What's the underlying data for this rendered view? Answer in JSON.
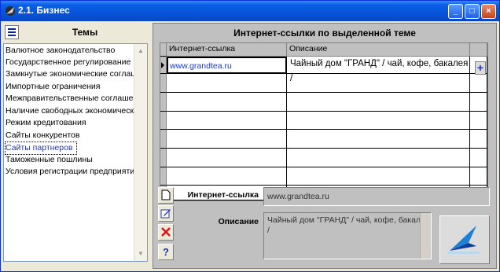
{
  "window": {
    "title": "2.1. Бизнес"
  },
  "title_buttons": {
    "minimize": "_",
    "maximize": "□",
    "close": "×"
  },
  "left": {
    "title": "Темы",
    "items": [
      "Валютное законодательство",
      "Государственное регулирование",
      "Замкнутые экономические соглашения",
      "Импортные ограничения",
      "Межправительственные соглашения",
      "Наличие свободных экономических зон",
      "Режим кредитования",
      "Сайты конкурентов",
      "Сайты партнеров",
      "Таможенные пошлины",
      "Условия регистрации предприятий"
    ],
    "selected_index": 8
  },
  "right": {
    "title": "Интернет-ссылки по выделенной теме",
    "columns": [
      "Интернет-ссылка",
      "Описание"
    ],
    "rows": [
      {
        "url": "www.grandtea.ru",
        "description": "Чайный дом \"ГРАНД\" / чай, кофе, бакалея /"
      }
    ],
    "plus_label": "+",
    "detail": {
      "url_label": "Интернет-ссылка",
      "url_value": "www.grandtea.ru",
      "desc_label": "Описание",
      "desc_value": "Чайный дом \"ГРАНД\" / чай, кофе, бакалея /"
    },
    "tools": {
      "new_icon": "new-document-icon",
      "edit_icon": "edit-icon",
      "delete_icon": "delete-icon",
      "help_label": "?"
    }
  },
  "colors": {
    "title_bar": "#0a5fe6",
    "link": "#1a39c8",
    "panel": "#c0c0c0"
  }
}
